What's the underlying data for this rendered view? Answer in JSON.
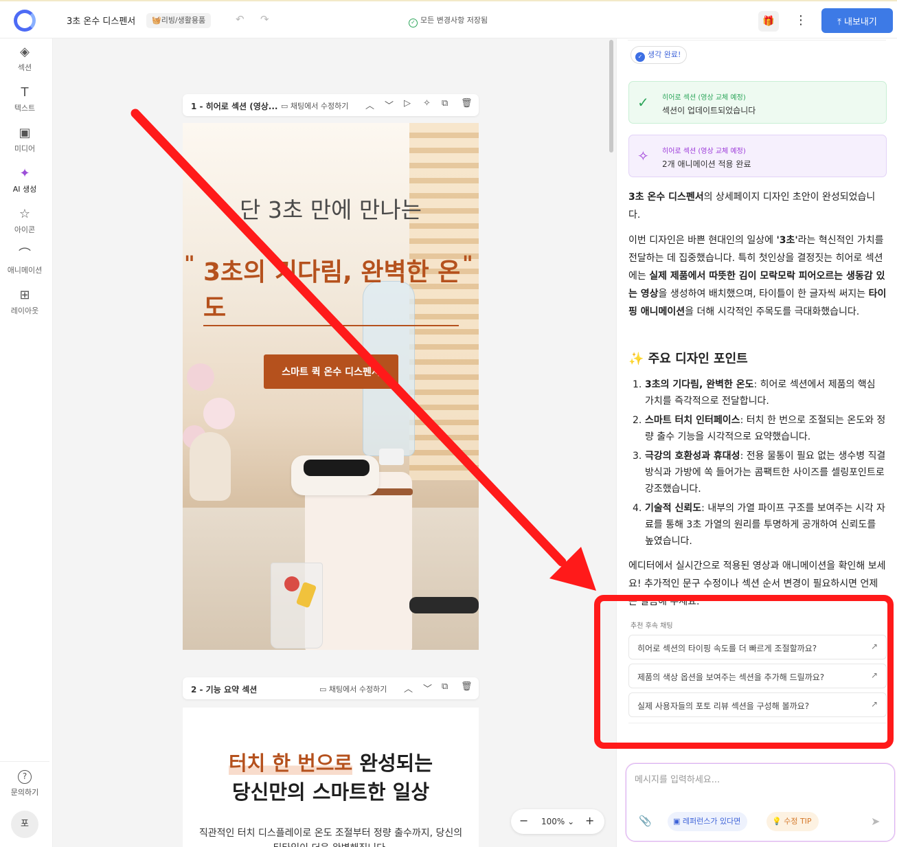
{
  "header": {
    "doc_title": "3초 온수 디스펜서",
    "category": "🧺리빙/생활용품",
    "save_status": "모든 변경사항 저장됨",
    "export_label": "내보내기"
  },
  "toolbar": {
    "items": [
      {
        "label": "섹션",
        "icon": "layers-icon"
      },
      {
        "label": "텍스트",
        "icon": "text-icon"
      },
      {
        "label": "미디어",
        "icon": "image-icon"
      },
      {
        "label": "AI 생성",
        "icon": "magic-wand-icon"
      },
      {
        "label": "아이콘",
        "icon": "star-icon"
      },
      {
        "label": "애니메이션",
        "icon": "curve-icon"
      },
      {
        "label": "레이아웃",
        "icon": "grid-icon"
      }
    ],
    "help_label": "문의하기",
    "avatar_initial": "포"
  },
  "canvas": {
    "section1": {
      "name": "1 - 히어로 섹션 (영상...",
      "edit_label": "채팅에서 수정하기",
      "subtitle": "단 3초 만에 만나는",
      "headline": "3초의 기다림, 완벽한 온도",
      "quote_open": "\"",
      "quote_close": "\"",
      "cta": "스마트 퀵 온수 디스펜서"
    },
    "section2": {
      "name": "2 - 기능 요약 섹션",
      "edit_label": "채팅에서 수정하기",
      "heading_highlight": "터치 한 번으로",
      "heading_rest": " 완성되는",
      "heading_line2": "당신만의 스마트한 일상",
      "paragraph": "직관적인 터치 디스플레이로 온도 조절부터 정량 출수까지, 당신의 티타임이 더욱 완벽해집니다."
    },
    "zoom": "100%"
  },
  "chat": {
    "thinking": "생각 완료!",
    "card1": {
      "title": "히어로 섹션 (영상 교체 예정)",
      "message": "섹션이 업데이트되었습니다"
    },
    "card2": {
      "title": "히어로 섹션 (영상 교체 예정)",
      "message": "2개 애니메이션 적용 완료"
    },
    "intro_bold": "3초 온수 디스펜서",
    "intro_rest": "의 상세페이지 디자인 초안이 완성되었습니다.",
    "p2_a": "이번 디자인은 바쁜 현대인의 일상에 ",
    "p2_b": "'3초'",
    "p2_c": "라는 혁신적인 가치를 전달하는 데 집중했습니다. 특히 첫인상을 결정짓는 히어로 섹션에는 ",
    "p2_d": "실제 제품에서 따뜻한 김이 모락모락 피어오르는 생동감 있는 영상",
    "p2_e": "을 생성하여 배치했으며, 타이틀이 한 글자씩 써지는 ",
    "p2_f": "타이핑 애니메이션",
    "p2_g": "을 더해 시각적인 주목도를 극대화했습니다.",
    "points_title": "주요 디자인 포인트",
    "points_icon": "✨",
    "points": [
      {
        "num": "1.",
        "bold": "3초의 기다림, 완벽한 온도",
        "text": ": 히어로 섹션에서 제품의 핵심 가치를 즉각적으로 전달합니다."
      },
      {
        "num": "2.",
        "bold": "스마트 터치 인터페이스",
        "text": ": 터치 한 번으로 조절되는 온도와 정량 출수 기능을 시각적으로 요약했습니다."
      },
      {
        "num": "3.",
        "bold": "극강의 호환성과 휴대성",
        "text": ": 전용 물통이 필요 없는 생수병 직결 방식과 가방에 쏙 들어가는 콤팩트한 사이즈를 셀링포인트로 강조했습니다."
      },
      {
        "num": "4.",
        "bold": "기술적 신뢰도",
        "text": ": 내부의 가열 파이프 구조를 보여주는 시각 자료를 통해 3초 가열의 원리를 투명하게 공개하여 신뢰도를 높였습니다."
      }
    ],
    "outro": "에디터에서 실시간으로 적용된 영상과 애니메이션을 확인해 보세요! 추가적인 문구 수정이나 섹션 순서 변경이 필요하시면 언제든 말씀해 주세요.",
    "suggest_label": "추천 후속 채팅",
    "suggestions": [
      "히어로 섹션의 타이핑 속도를 더 빠르게 조절할까요?",
      "제품의 색상 옵션을 보여주는 섹션을 추가해 드릴까요?",
      "실제 사용자들의 포토 리뷰 섹션을 구성해 볼까요?"
    ],
    "input_placeholder": "메시지를 입력하세요...",
    "ref_label": "레퍼런스가 있다면",
    "tip_label": "수정 TIP"
  },
  "colors": {
    "accent_brown": "#b5511d",
    "primary_blue": "#3d7ae6",
    "annotation_red": "#ff1a1a"
  }
}
